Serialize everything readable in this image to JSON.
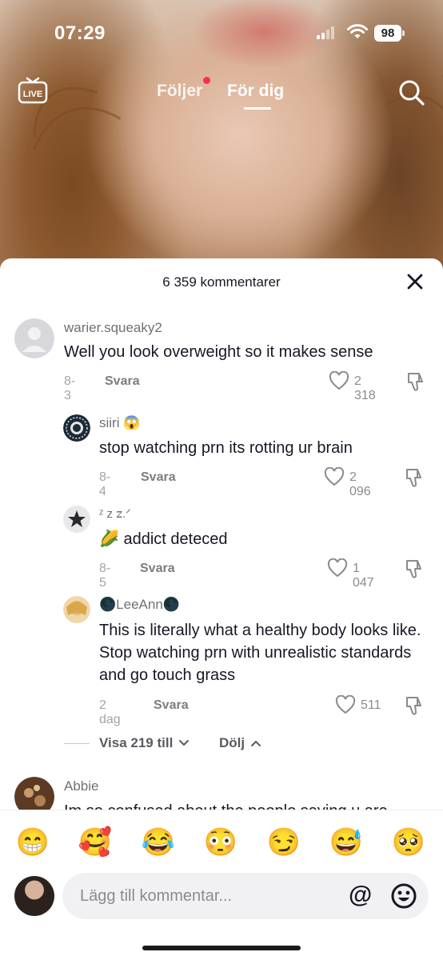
{
  "status_bar": {
    "time": "07:29",
    "battery": "98"
  },
  "top_nav": {
    "live_label": "LIVE",
    "following_label": "Följer",
    "for_you_label": "För dig"
  },
  "sheet": {
    "comment_count": "6 359 kommentarer",
    "comments": [
      {
        "user": "warier.squeaky2",
        "text": "Well you look overweight so it makes sense",
        "date": "8-3",
        "reply": "Svara",
        "likes": "2 318"
      },
      {
        "user": "siiri 😱",
        "text": "stop watching prn its rotting ur brain",
        "date": "8-4",
        "reply": "Svara",
        "likes": "2 096"
      },
      {
        "user": "ᶻ z 𝗓.ᐟ",
        "text": "🌽 addict deteced",
        "date": "8-5",
        "reply": "Svara",
        "likes": "1 047"
      },
      {
        "user": "🌑LeeAnn🌑",
        "text": "This is literally what a healthy body looks like. Stop watching prn with unrealistic standards and go touch grass",
        "date": "2 dag",
        "reply": "Svara",
        "likes": "511"
      },
      {
        "user": "Abbie",
        "text": "Im so confused about the people saying u are"
      }
    ],
    "view_more": "Visa 219 till",
    "hide": "Dölj"
  },
  "bottom_bar": {
    "emojis": [
      "😁",
      "🥰",
      "😂",
      "😳",
      "😏",
      "😅",
      "🥺"
    ],
    "input_placeholder": "Lägg till kommentar...",
    "at_symbol": "@"
  },
  "colors": {
    "accent": "#fe2c55",
    "text": "#161823",
    "muted": "#8a8b90"
  }
}
